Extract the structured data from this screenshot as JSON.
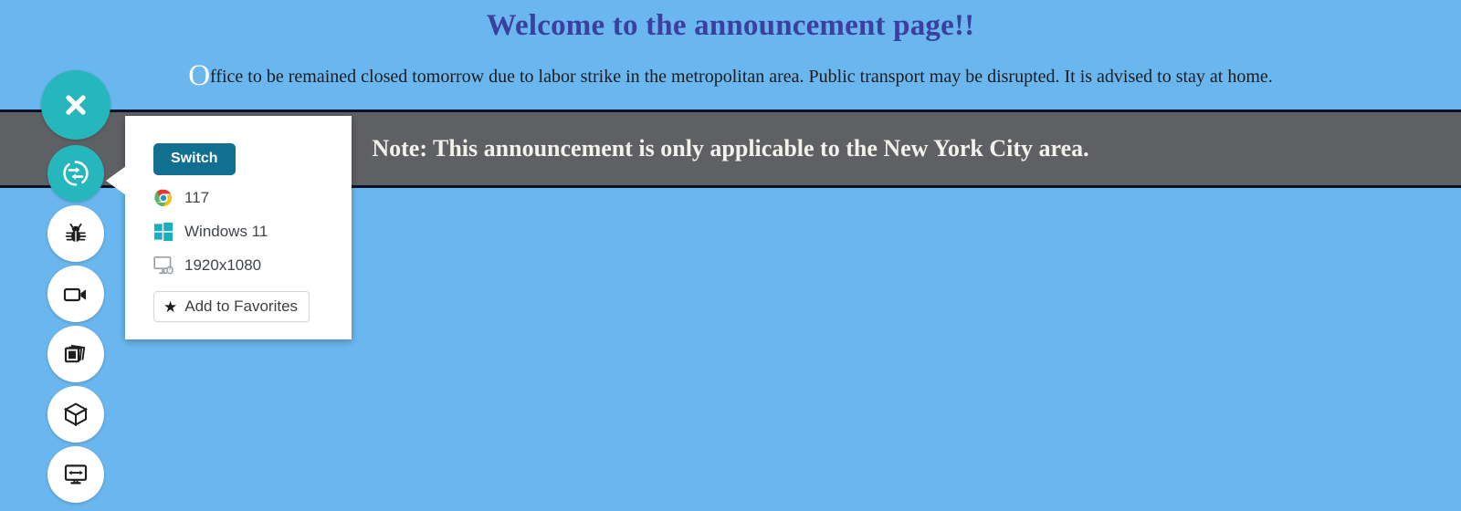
{
  "page": {
    "background_color": "#6ab7ef",
    "title": "Welcome to the announcement page!!",
    "title_color": "#3b3f9e",
    "announcement_dropcap": "O",
    "announcement_rest": "ffice to be remained closed tomorrow due to labor strike in the metropolitan area. Public transport may be disrupted. It is advised to stay at home.",
    "note_banner": {
      "text": "Note: This announcement is only applicable to the New York City area.",
      "background_color": "#5f6063",
      "text_color": "#f3f1ec"
    }
  },
  "sidebar": {
    "accent_color": "#26b7bd",
    "items": [
      {
        "name": "close",
        "icon": "close-icon",
        "style": "teal"
      },
      {
        "name": "switch",
        "icon": "switch-icon",
        "style": "teal"
      },
      {
        "name": "bug",
        "icon": "bug-icon",
        "style": "white"
      },
      {
        "name": "record",
        "icon": "video-camera-icon",
        "style": "white"
      },
      {
        "name": "screenshots",
        "icon": "screenshots-icon",
        "style": "white"
      },
      {
        "name": "cube",
        "icon": "cube-icon",
        "style": "white"
      },
      {
        "name": "responsive",
        "icon": "monitor-resize-icon",
        "style": "white"
      }
    ]
  },
  "popup": {
    "switch_label": "Switch",
    "switch_color": "#11708f",
    "browser_version": "117",
    "os": "Windows 11",
    "resolution": "1920x1080",
    "favorites_label": "Add to Favorites",
    "icons": {
      "browser": "chrome-icon",
      "os": "windows-icon",
      "resolution": "monitor-icon",
      "favorites": "star-icon"
    }
  }
}
